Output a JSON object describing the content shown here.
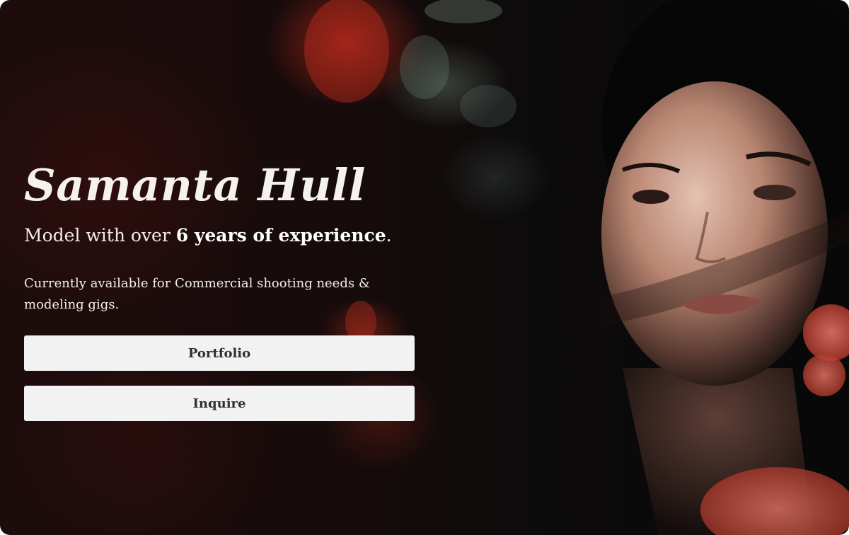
{
  "hero": {
    "name": "Samanta Hull",
    "tagline_prefix": "Model with over ",
    "tagline_highlight": "6 years of experience",
    "tagline_suffix": ".",
    "availability": "Currently available for Commercial shooting needs & modeling gigs.",
    "buttons": {
      "portfolio": "Portfolio",
      "inquire": "Inquire"
    }
  },
  "colors": {
    "background_dark": "#120a0a",
    "text_light": "#f5f2ee",
    "button_bg": "#f2f2f2",
    "button_text": "#2f2f2f",
    "flower_red": "#b42819"
  }
}
